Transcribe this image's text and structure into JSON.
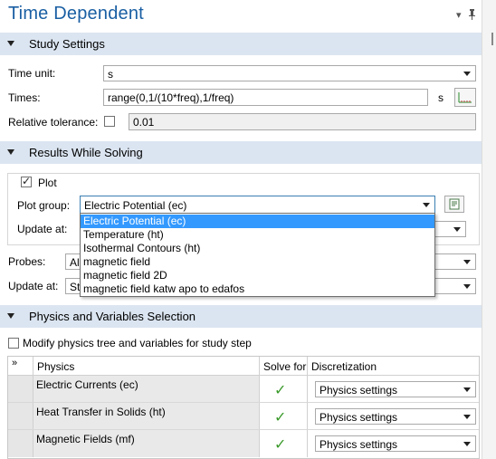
{
  "title": "Time Dependent",
  "titlebar_icons": {
    "menu": "▾",
    "pin": "pin-icon"
  },
  "sections": {
    "study_settings": "Study Settings",
    "results_while_solving": "Results While Solving",
    "physics_vars": "Physics and Variables Selection"
  },
  "study": {
    "time_unit_label": "Time unit:",
    "time_unit_value": "s",
    "times_label": "Times:",
    "times_value": "range(0,1/(10*freq),1/freq)",
    "times_unit": "s",
    "rel_tol_label": "Relative tolerance:",
    "rel_tol_value": "0.01"
  },
  "results": {
    "plot_label": "Plot",
    "plot_group_label": "Plot group:",
    "plot_group_value": "Electric Potential (ec)",
    "update_at_label": "Update at:",
    "probes_label": "Probes:",
    "probes_value": "Al",
    "update_at2_label": "Update at:",
    "update_at2_value": "St",
    "dropdown_options": [
      "Electric Potential (ec)",
      "Temperature (ht)",
      "Isothermal Contours (ht)",
      "magnetic field",
      "magnetic field 2D",
      "magnetic field katw apo to edafos"
    ]
  },
  "physics": {
    "modify_label": "Modify physics tree and variables for study step",
    "headers": {
      "expand": "»",
      "physics": "Physics",
      "solve_for": "Solve for",
      "discretization": "Discretization"
    },
    "rows": [
      {
        "name": "Electric Currents (ec)",
        "discretization": "Physics settings"
      },
      {
        "name": "Heat Transfer in Solids (ht)",
        "discretization": "Physics settings"
      },
      {
        "name": "Magnetic Fields (mf)",
        "discretization": "Physics settings"
      }
    ]
  },
  "colors": {
    "title": "#1a5fa3",
    "section_bg": "#dbe5f1",
    "selection": "#3399ff",
    "check": "#3a9a2a"
  }
}
